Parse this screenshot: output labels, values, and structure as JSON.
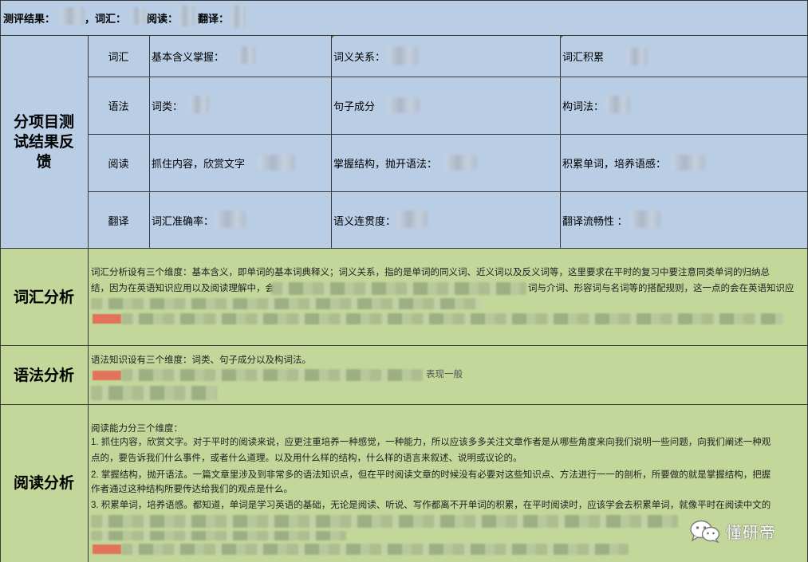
{
  "top": {
    "result_label": "测评结果：",
    "vocab_label": "，词汇：",
    "reading_label": "阅读：",
    "translation_label": "翻译："
  },
  "feedback": {
    "title": "分项目测试结果反馈",
    "rows": [
      {
        "category": "词汇",
        "cells": [
          "基本含义掌握：",
          "词义关系：",
          "词汇积累"
        ]
      },
      {
        "category": "语法",
        "cells": [
          "词类：",
          "句子成分",
          "构词法："
        ]
      },
      {
        "category": "阅读",
        "cells": [
          "抓住内容，欣赏文字",
          "掌握结构，抛开语法：",
          "积累单词，培养语感："
        ]
      },
      {
        "category": "翻译",
        "cells": [
          "词汇准确率：",
          "语义连贯度：",
          "翻译流畅性 ："
        ]
      }
    ]
  },
  "vocab_analysis": {
    "title": "词汇分析",
    "line1": "词汇分析设有三个维度：基本含义，即单词的基本词典释义；词义关系，指的是单词的同义词、近义词以及反义词等，这里要求在平时的复习中要注意同类单词的归纳总",
    "line2_a": "结，因为在英语知识应用以及阅读理解中，会",
    "line2_b": "词与介词、形容词与名词等的搭配规则，这一点的会在英语知识应"
  },
  "grammar_analysis": {
    "title": "语法分析",
    "line1": "语法知识设有三个维度：词类、句子成分以及构词法。",
    "line2_tail": "表现一般"
  },
  "reading_analysis": {
    "title": "阅读分析",
    "lines": [
      "阅读能力分三个维度：",
      "1. 抓住内容，欣赏文字。对于平时的阅读来说，应更注重培养一种感觉，一种能力，所以应该多多关注文章作者是从哪些角度来向我们说明一些问题，向我们阐述一种观",
      "点的，要告诉我们什么事件，或者什么道理。以及用什么样的结构，什么样的语言来叙述、说明或议论的。",
      "2. 掌握结构，抛开语法。一篇文章里涉及到非常多的语法知识点，但在平时阅读文章的时候没有必要对这些知识点、方法进行一一的剖析，所要做的就是掌握结构，把握",
      "作者通过这种结构所要传达给我们的观点是什么。",
      "3. 积累单词，培养语感。都知道，单词是学习英语的基础，无论是阅读、听说、写作都离不开单词的积累，在平时阅读时，应该学会去积累单词，就像平时在阅读中文的"
    ]
  },
  "watermark": {
    "text": "懂研帝",
    "icon": "wechat-icon"
  },
  "colors": {
    "header_bg": "#b9cde5",
    "analysis_bg": "#c4d79b",
    "highlight": "#e0735a"
  }
}
